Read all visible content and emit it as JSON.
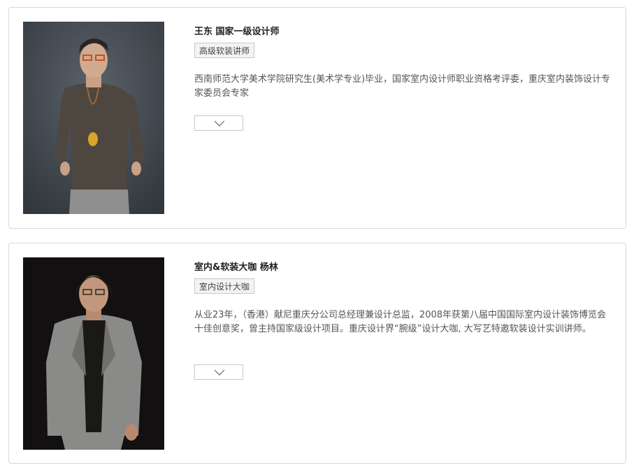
{
  "designers": [
    {
      "title": "王东 国家一级设计师",
      "tag": "高级软装讲师",
      "description": "西南师范大学美术学院研究生(美术学专业)毕业，国家室内设计师职业资格考评委，重庆室内装饰设计专家委员会专家",
      "photo_background": "#3e444b",
      "expand_icon": "chevron-down-icon"
    },
    {
      "title": "室内&软装大咖 杨林",
      "tag": "室内设计大咖",
      "description": "从业23年，（香港）献尼重庆分公司总经理兼设计总监，2008年获第八届中国国际室内设计装饰博览会十佳创意奖，曾主持国家级设计项目。重庆设计界“腕级”设计大咖, 大写艺特邀软装设计实训讲师。",
      "photo_background": "#121010",
      "expand_icon": "chevron-down-icon"
    }
  ],
  "colors": {
    "card_border": "#d9d9d9",
    "tag_background": "#f3f3f3",
    "text_primary": "#222222",
    "text_body": "#555555"
  }
}
